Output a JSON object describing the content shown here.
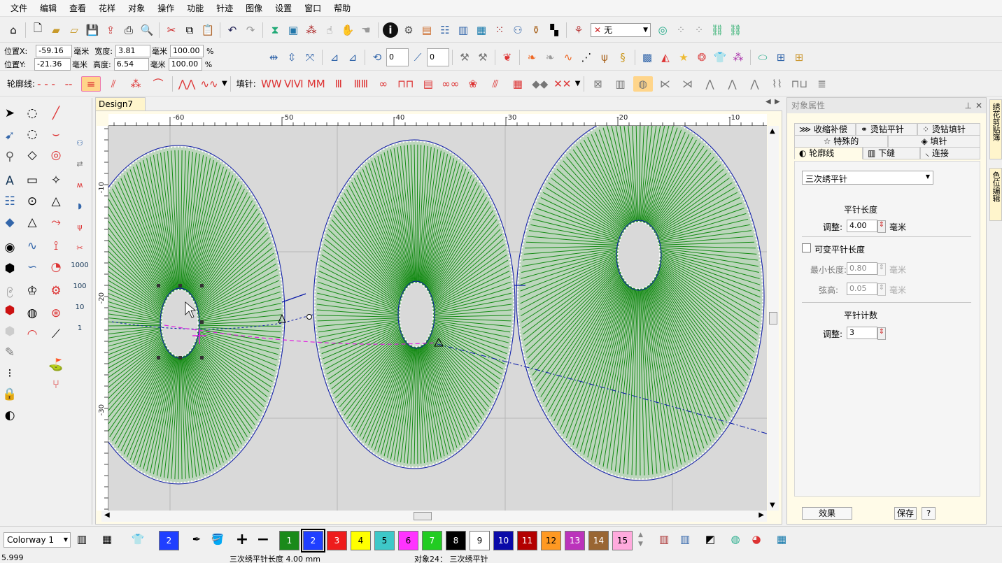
{
  "menu": [
    "文件",
    "编辑",
    "查看",
    "花样",
    "对象",
    "操作",
    "功能",
    "针迹",
    "图像",
    "设置",
    "窗口",
    "帮助"
  ],
  "position": {
    "x_label": "位置X:",
    "x_value": "-59.16",
    "y_label": "位置Y:",
    "y_value": "-21.36",
    "width_label": "宽度:",
    "width_value": "3.81",
    "height_label": "高度:",
    "height_value": "6.54",
    "unit": "毫米",
    "pct_width": "100.00",
    "pct_height": "100.00",
    "pct": "%"
  },
  "toolbar": {
    "rotate_value": "0",
    "skew_value": "0",
    "thread_select": "无",
    "outline_label": "轮廓线:",
    "fill_label": "填针:"
  },
  "doc_tab": {
    "label": "Design7",
    "close": "✕"
  },
  "ruler_h": [
    "-60",
    "-50",
    "-40",
    "-30",
    "-20",
    "-10"
  ],
  "ruler_v": [
    "-10",
    "-20",
    "-30"
  ],
  "panel": {
    "title": "对象属性",
    "tabs_row1": [
      "收缩补偿",
      "烫钻平针",
      "烫钻填针"
    ],
    "tabs_row2": [
      "特殊的",
      "填针"
    ],
    "tabs_row3": [
      "轮廓线",
      "下缝",
      "连接"
    ],
    "stitch_type": "三次绣平针",
    "section_length": "平针长度",
    "adjust_label": "调整:",
    "adjust_value": "4.00",
    "unit": "毫米",
    "variable_label": "可变平针长度",
    "min_label": "最小长度:",
    "min_value": "0.80",
    "chord_label": "弦高:",
    "chord_value": "0.05",
    "section_count": "平针计数",
    "count_label": "调整:",
    "count_value": "3",
    "effect_btn": "效果",
    "save_btn": "保存",
    "help_btn": "?"
  },
  "right_side_tabs": [
    "绣花剪贴簿",
    "色位编辑"
  ],
  "bottom": {
    "colorway": "Colorway 1",
    "current_color": "2",
    "swatches": [
      {
        "n": "1",
        "color": "#1a8a1a"
      },
      {
        "n": "2",
        "color": "#1f3fff"
      },
      {
        "n": "3",
        "color": "#ee1c1c"
      },
      {
        "n": "4",
        "color": "#ffff00"
      },
      {
        "n": "5",
        "color": "#3ec8c8"
      },
      {
        "n": "6",
        "color": "#ff33ff"
      },
      {
        "n": "7",
        "color": "#22cc22"
      },
      {
        "n": "8",
        "color": "#000000"
      },
      {
        "n": "9",
        "color": "#ffffff"
      },
      {
        "n": "10",
        "color": "#0a0aa8"
      },
      {
        "n": "11",
        "color": "#b30000"
      },
      {
        "n": "12",
        "color": "#ff9922"
      },
      {
        "n": "13",
        "color": "#bb33bb"
      },
      {
        "n": "14",
        "color": "#996633"
      },
      {
        "n": "15",
        "color": "#ffaadd"
      }
    ]
  },
  "status": {
    "left": "5.999",
    "center": "三次绣平针长度   4.00 mm",
    "right": "对象24： 三次绣平针"
  },
  "colors": {
    "stitch": "#138a13",
    "fill": "#bcd6bc",
    "outline": "#0a1aa8"
  }
}
